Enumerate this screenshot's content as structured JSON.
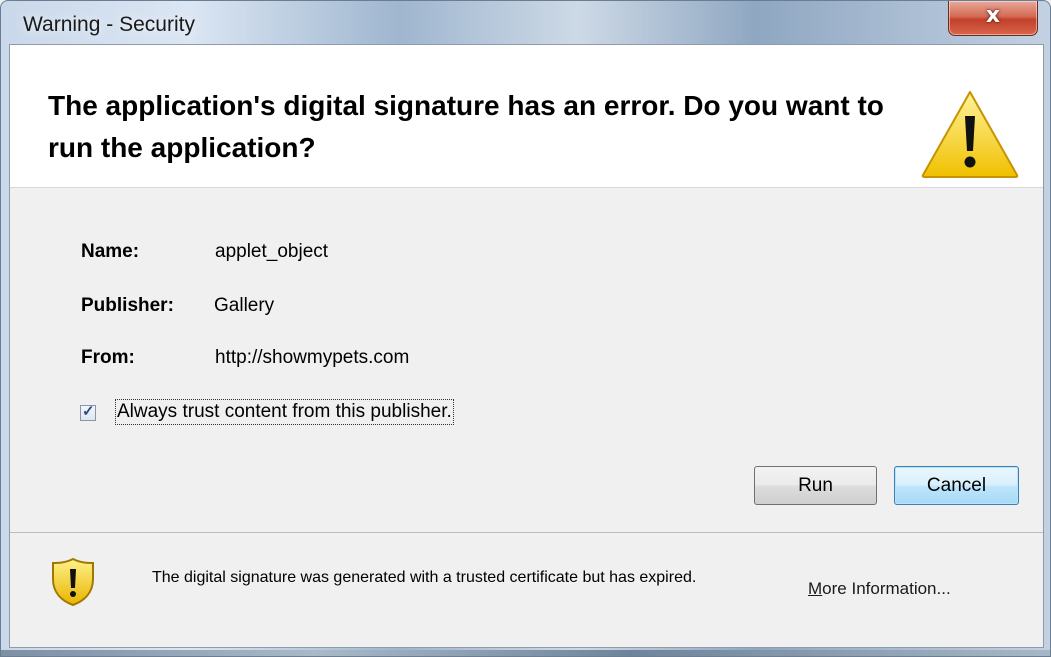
{
  "window": {
    "title": "Warning - Security",
    "close_glyph": "x"
  },
  "header": {
    "headline": "The application's digital signature has an error.  Do you want to run the application?",
    "icon": "warning-triangle-icon"
  },
  "details": {
    "name_label": "Name:",
    "name_value": "applet_object",
    "publisher_label": "Publisher:",
    "publisher_value": "Gallery",
    "from_label": "From:",
    "from_value": "http://showmypets.com"
  },
  "trust": {
    "label": "Always trust content from this publisher.",
    "checked": true
  },
  "buttons": {
    "run": "Run",
    "cancel": "Cancel"
  },
  "footer": {
    "icon": "warning-shield-icon",
    "message": "The digital signature was generated with a trusted certificate but has expired.",
    "more_info_accel": "M",
    "more_info_rest": "ore Information..."
  },
  "colors": {
    "warning_yellow": "#f5d22a",
    "default_button_border": "#3c7fb1",
    "close_button_red": "#c2412a"
  }
}
